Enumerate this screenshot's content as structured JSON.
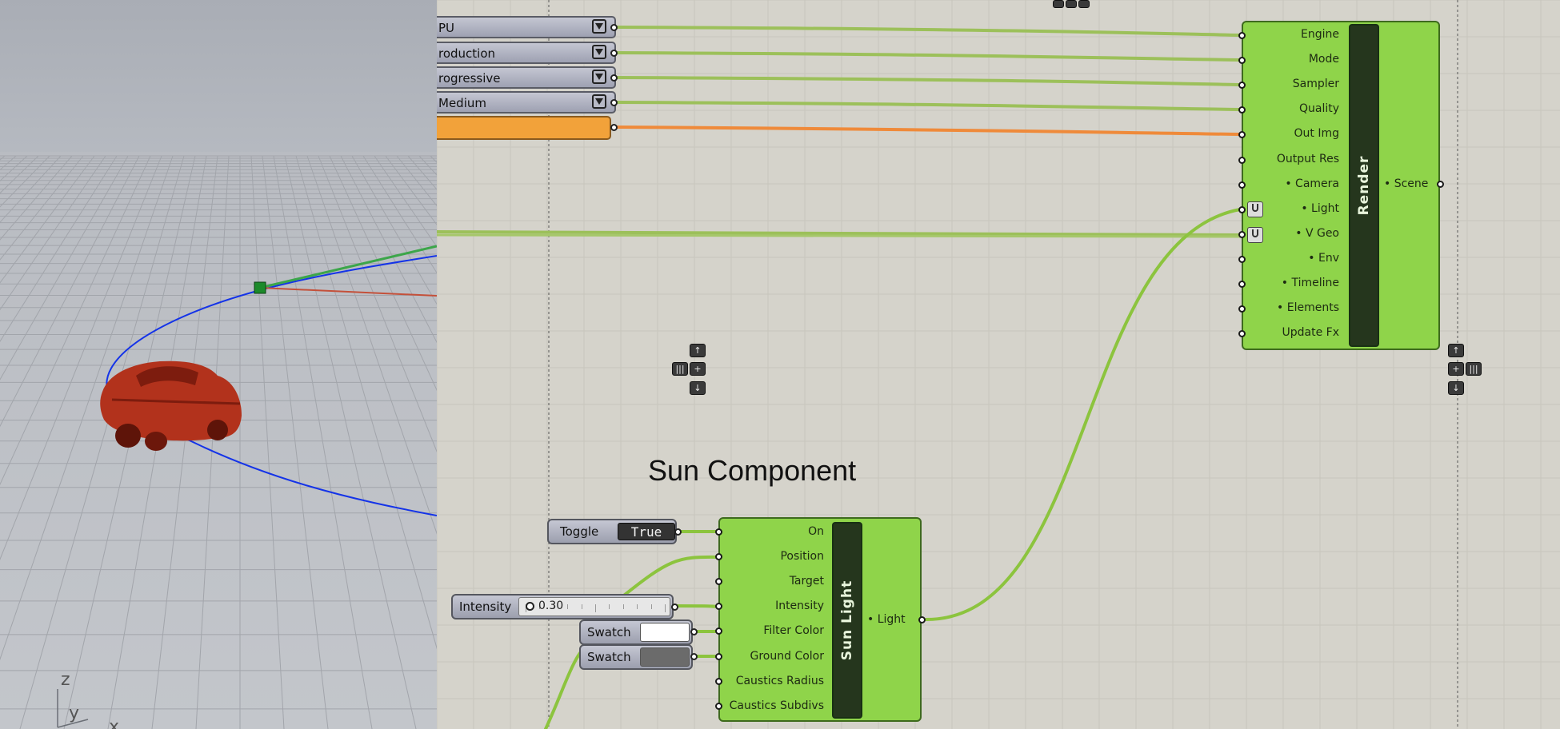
{
  "value_lists": [
    {
      "value": "PU"
    },
    {
      "value": "roduction"
    },
    {
      "value": "rogressive"
    },
    {
      "value": "Medium"
    }
  ],
  "render_component": {
    "title": "Render",
    "inputs": [
      "Engine",
      "Mode",
      "Sampler",
      "Quality",
      "Out Img",
      "Output Res",
      "• Camera",
      "• Light",
      "• V Geo",
      "• Env",
      "• Timeline",
      "• Elements",
      "Update Fx"
    ],
    "output": "• Scene"
  },
  "group_label": "Sun Component",
  "sun_component": {
    "title": "Sun Light",
    "inputs": [
      "On",
      "Position",
      "Target",
      "Intensity",
      "Filter Color",
      "Ground Color",
      "Caustics Radius",
      "Caustics Subdivs"
    ],
    "output": "• Light"
  },
  "toggle": {
    "label": "Toggle",
    "value": "True"
  },
  "slider": {
    "label": "Intensity",
    "value": "0.30",
    "fraction": 0.3
  },
  "swatches": [
    {
      "label": "Swatch",
      "color": "#ffffff"
    },
    {
      "label": "Swatch",
      "color": "#6b6b6b"
    }
  ],
  "viewport_axes": {
    "z": "z",
    "y": "y",
    "x": "x"
  },
  "colors": {
    "component_green": "#8fd44a",
    "wire_green": "#8cc43e",
    "wire_orange": "#ef8a3a",
    "panel_orange": "#f2a23a",
    "viewport_bg": "#b4b8bf",
    "car": "#b2321c"
  }
}
